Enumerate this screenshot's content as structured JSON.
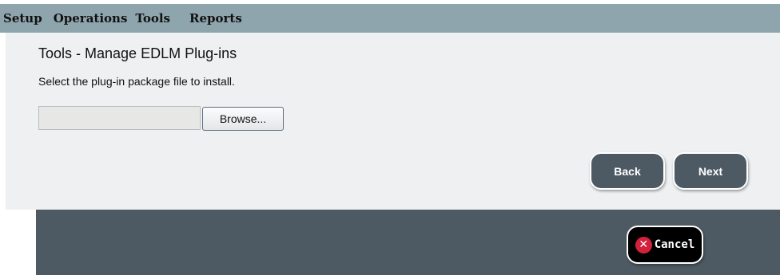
{
  "menu": {
    "items": [
      {
        "label": "Setup"
      },
      {
        "label": "Operations"
      },
      {
        "label": "Tools"
      },
      {
        "label": "Reports"
      }
    ]
  },
  "page": {
    "title": "Tools - Manage EDLM Plug-ins",
    "instruction": "Select the plug-in package file to install."
  },
  "file_picker": {
    "value": "",
    "browse_label": "Browse..."
  },
  "navigation": {
    "back_label": "Back",
    "next_label": "Next"
  },
  "footer": {
    "cancel_label": "Cancel",
    "cancel_icon": "x-circle-icon",
    "cancel_icon_color": "#d2213a"
  },
  "colors": {
    "menubar": "#8fa5ad",
    "content_bg": "#eef0f2",
    "footer_bg": "#4d5a63"
  }
}
